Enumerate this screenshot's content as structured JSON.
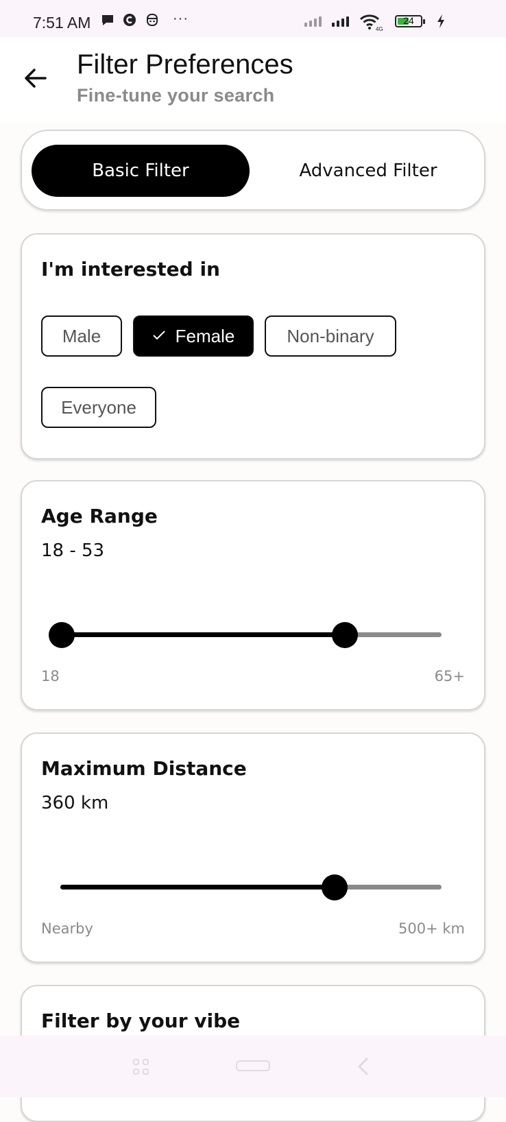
{
  "status_bar": {
    "time": "7:51 AM",
    "icons": [
      "chat-icon",
      "c-icon",
      "face-icon",
      "more-icon",
      "signal-icon",
      "wifi-icon",
      "battery-icon",
      "charging-icon"
    ],
    "more": "···",
    "battery": "24",
    "network": "4G"
  },
  "header": {
    "title": "Filter Preferences",
    "subtitle": "Fine-tune your search"
  },
  "tabs": {
    "active": "Basic Filter",
    "inactive": "Advanced Filter"
  },
  "interested": {
    "title": "I'm interested in",
    "options": [
      "Male",
      "Female",
      "Non-binary",
      "Everyone"
    ],
    "selected": "Female"
  },
  "age": {
    "title": "Age Range",
    "value": "18 - 53",
    "min_label": "18",
    "max_label": "65+",
    "range_min": 18,
    "range_max": 65,
    "low": 18,
    "high": 53
  },
  "distance": {
    "title": "Maximum Distance",
    "value": "360 km",
    "min_label": "Nearby",
    "max_label": "500+ km",
    "level": 0.72
  },
  "vibe": {
    "title": "Filter by your vibe"
  },
  "colors": {
    "accent": "#000000",
    "track_inactive": "#8a8a8a",
    "background": "#fdfcfa"
  }
}
